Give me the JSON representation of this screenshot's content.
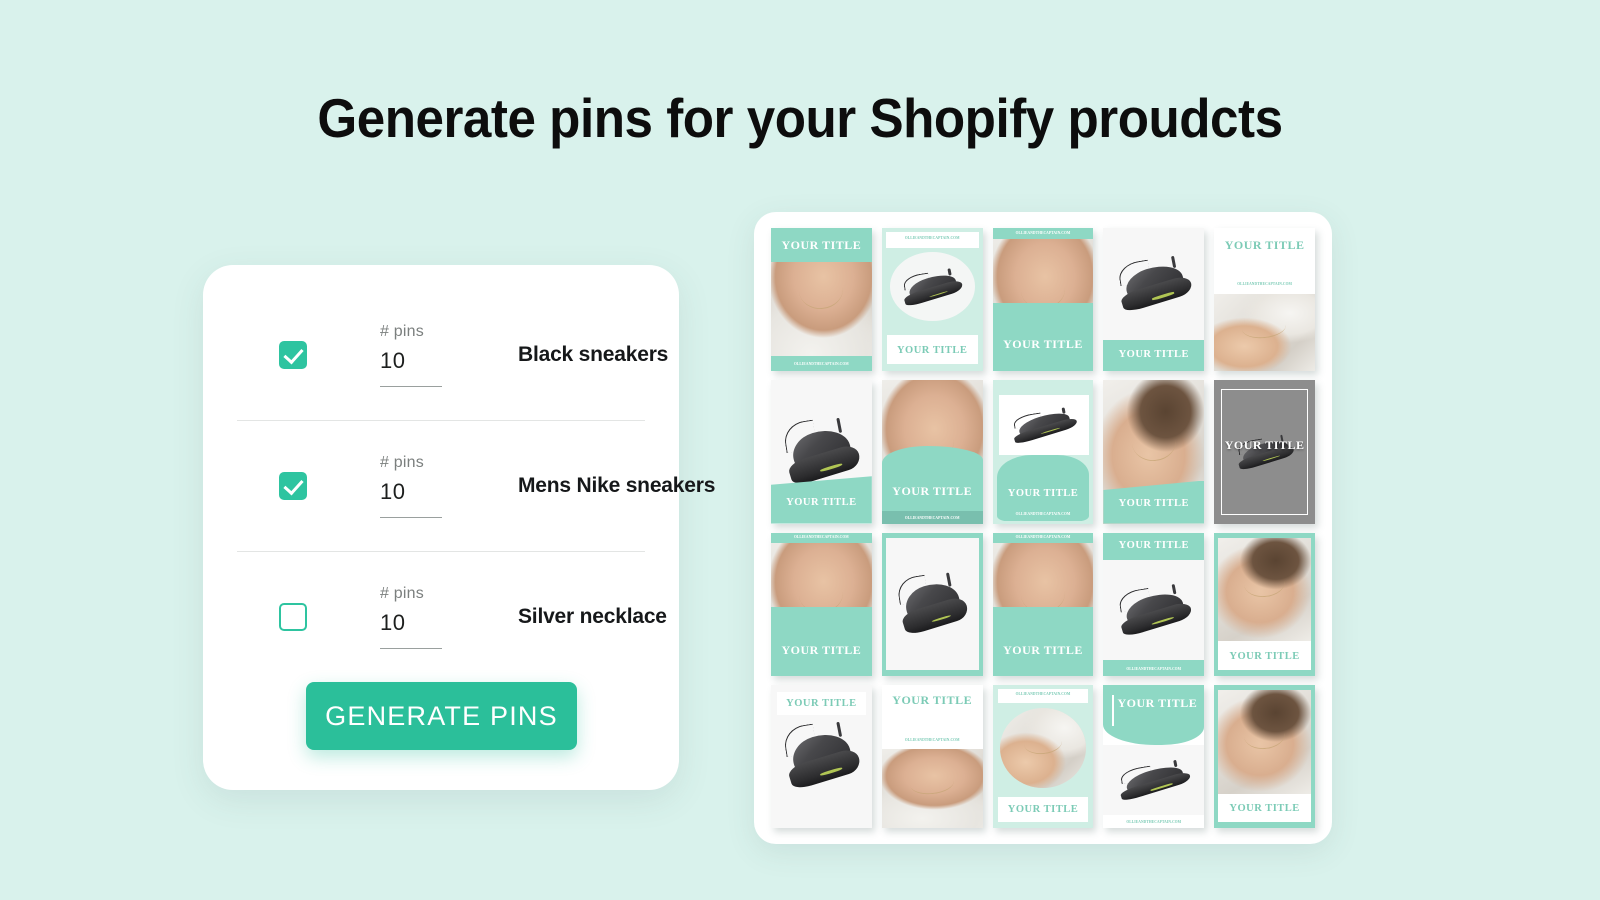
{
  "page": {
    "title": "Generate pins for your Shopify proudcts",
    "background_color": "#d9f2ec",
    "accent_color": "#2bbf9a",
    "pin_mint_color": "#8ed8c4"
  },
  "config_card": {
    "pins_label": "# pins",
    "rows": [
      {
        "checked": true,
        "pins": "10",
        "product": "Black sneakers"
      },
      {
        "checked": true,
        "pins": "10",
        "product": "Mens Nike sneakers"
      },
      {
        "checked": false,
        "pins": "10",
        "product": "Silver necklace"
      }
    ],
    "generate_button": "GENERATE PINS"
  },
  "pin_grid": {
    "title_text": "YOUR TITLE",
    "url_text": "OLLIEANDTHECAPTAIN.COM",
    "rows": 4,
    "columns": 5,
    "pins": [
      {
        "id": 1,
        "layout": "top-band-photo-bottom-url",
        "subject": "necklace",
        "title": "YOUR TITLE",
        "url": "OLLIEANDTHECAPTAIN.COM"
      },
      {
        "id": 2,
        "layout": "url-top-circle-shoe-title-box",
        "subject": "shoe",
        "title": "YOUR TITLE",
        "url": "OLLIEANDTHECAPTAIN.COM"
      },
      {
        "id": 3,
        "layout": "url-top-photo-bottom-band",
        "subject": "necklace",
        "title": "YOUR TITLE",
        "url": "OLLIEANDTHECAPTAIN.COM"
      },
      {
        "id": 4,
        "layout": "shoe-top-band-bottom",
        "subject": "shoe",
        "title": "YOUR TITLE",
        "url": ""
      },
      {
        "id": 5,
        "layout": "title-top-url-photo-bottom",
        "subject": "necklace",
        "title": "YOUR TITLE",
        "url": "OLLIEANDTHECAPTAIN.COM"
      },
      {
        "id": 6,
        "layout": "shoe-top-angled-band",
        "subject": "shoe",
        "title": "YOUR TITLE",
        "url": ""
      },
      {
        "id": 7,
        "layout": "photo-wave-band-url",
        "subject": "necklace",
        "title": "YOUR TITLE",
        "url": "OLLIEANDTHECAPTAIN.COM"
      },
      {
        "id": 8,
        "layout": "blob-shoe",
        "subject": "shoe",
        "title": "YOUR TITLE",
        "url": "OLLIEANDTHECAPTAIN.COM"
      },
      {
        "id": 9,
        "layout": "photo-angled-band",
        "subject": "necklace",
        "title": "YOUR TITLE",
        "url": ""
      },
      {
        "id": 10,
        "layout": "gray-frame-shoe",
        "subject": "shoe",
        "title": "YOUR TITLE",
        "url": ""
      },
      {
        "id": 11,
        "layout": "url-top-photo-band-bottom",
        "subject": "necklace",
        "title": "YOUR TITLE",
        "url": "OLLIEANDTHECAPTAIN.COM"
      },
      {
        "id": 12,
        "layout": "mint-outline-shoe",
        "subject": "shoe",
        "title": "YOUR TITLE",
        "url": ""
      },
      {
        "id": 13,
        "layout": "url-top-photo-band-bottom",
        "subject": "necklace",
        "title": "YOUR TITLE",
        "url": "OLLIEANDTHECAPTAIN.COM"
      },
      {
        "id": 14,
        "layout": "band-top-shoe-url-bottom",
        "subject": "shoe",
        "title": "YOUR TITLE",
        "url": "OLLIEANDTHECAPTAIN.COM"
      },
      {
        "id": 15,
        "layout": "mint-frame-photo-title-box",
        "subject": "necklace",
        "title": "YOUR TITLE",
        "url": ""
      },
      {
        "id": 16,
        "layout": "title-box-top-shoe",
        "subject": "shoe",
        "title": "YOUR TITLE",
        "url": ""
      },
      {
        "id": 17,
        "layout": "title-url-top-photo-bottom",
        "subject": "necklace",
        "title": "YOUR TITLE",
        "url": "OLLIEANDTHECAPTAIN.COM"
      },
      {
        "id": 18,
        "layout": "url-top-oval-photo-title",
        "subject": "necklace",
        "title": "YOUR TITLE",
        "url": "OLLIEANDTHECAPTAIN.COM"
      },
      {
        "id": 19,
        "layout": "curved-band-shoe-url",
        "subject": "shoe",
        "title": "YOUR TITLE",
        "url": "OLLIEANDTHECAPTAIN.COM"
      },
      {
        "id": 20,
        "layout": "mint-frame-photo-title-box",
        "subject": "necklace",
        "title": "YOUR TITLE",
        "url": ""
      }
    ]
  }
}
